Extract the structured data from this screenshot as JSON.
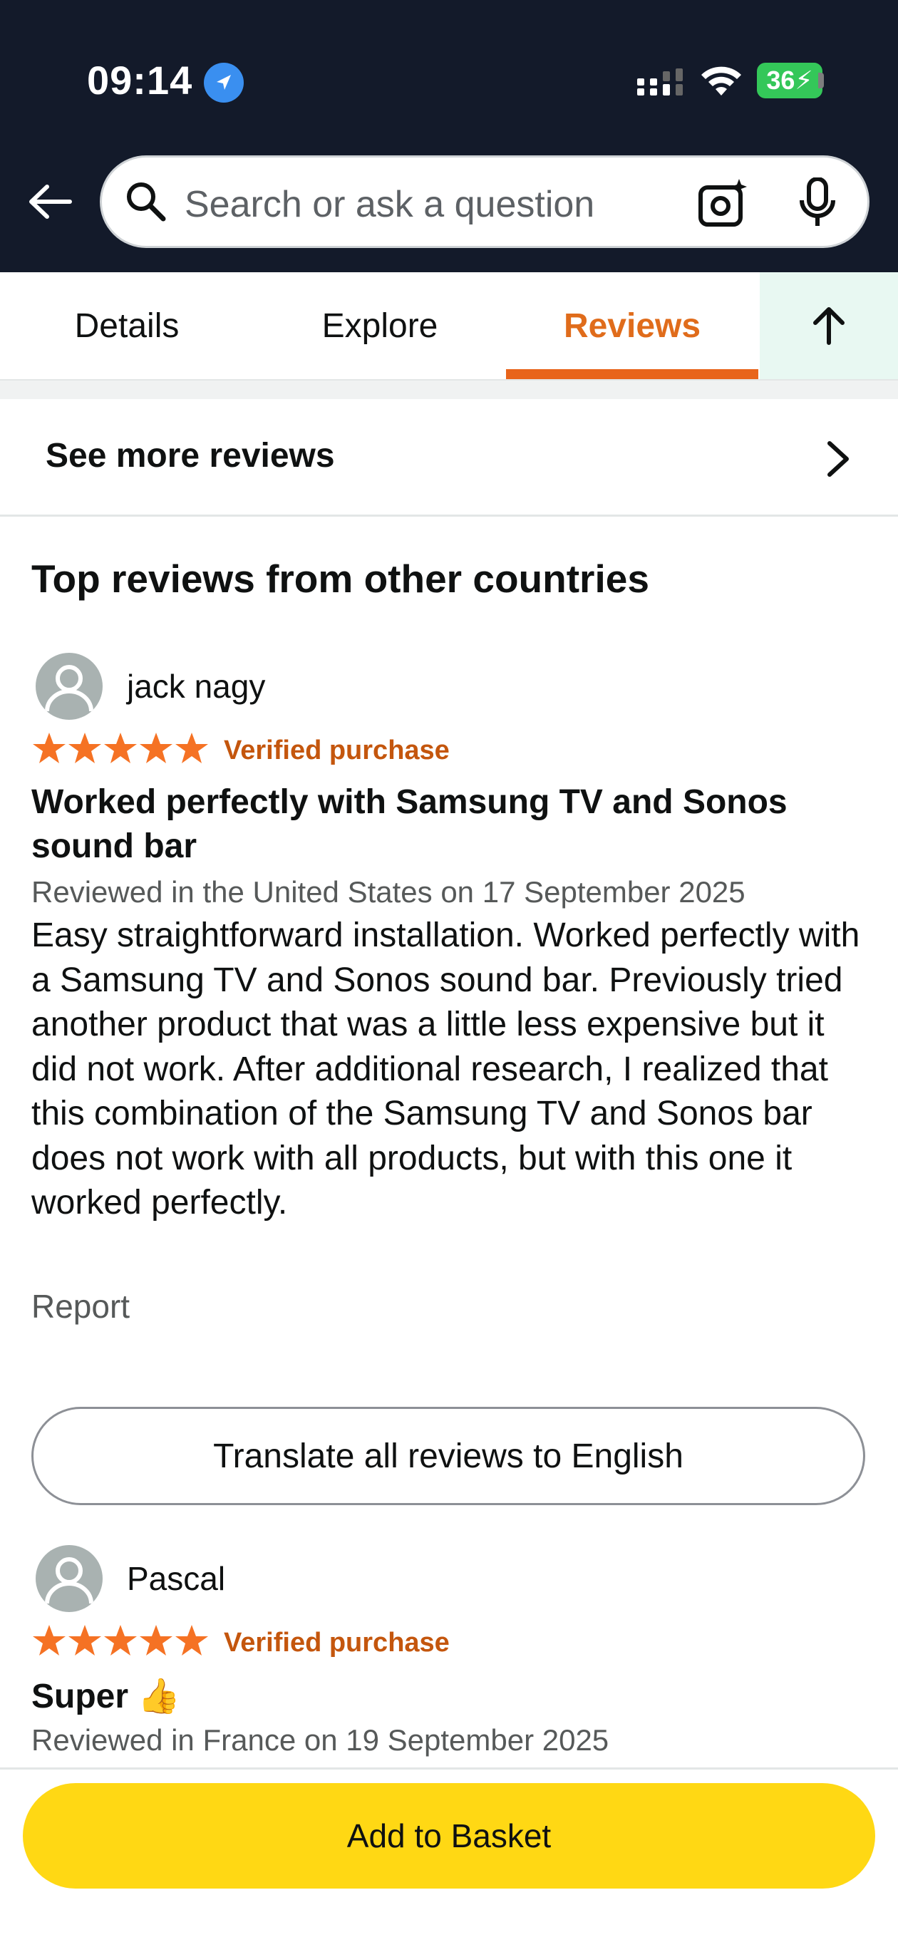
{
  "status_bar": {
    "time": "09:14",
    "battery": "36"
  },
  "search": {
    "placeholder": "Search or ask a question"
  },
  "tabs": [
    {
      "label": "Details"
    },
    {
      "label": "Explore"
    },
    {
      "label": "Reviews",
      "active": true
    }
  ],
  "see_more": {
    "label": "See more reviews"
  },
  "section": {
    "title": "Top reviews from other countries"
  },
  "reviews": [
    {
      "reviewer": "jack nagy",
      "rating": 5,
      "verified": "Verified purchase",
      "title": "Worked perfectly with Samsung TV and Sonos sound bar",
      "meta": "Reviewed in the United States on 17 September 2025",
      "body": "Easy straightforward installation. Worked perfectly with a Samsung TV and Sonos sound bar. Previously tried another product that was a little less expensive but it did not work. After additional research, I realized that this combination of the Samsung TV and Sonos bar does not work with all products, but with this one it worked perfectly.",
      "report": "Report"
    },
    {
      "reviewer": "Pascal",
      "rating": 5,
      "verified": "Verified purchase",
      "title": "Super 👍",
      "meta": "Reviewed in France on 19 September 2025"
    }
  ],
  "translate": {
    "label": "Translate all reviews to English"
  },
  "basket": {
    "label": "Add to Basket"
  },
  "colors": {
    "accent": "#e8641b",
    "basket": "#ffd814",
    "header": "#131a2a",
    "star": "#f57224"
  }
}
